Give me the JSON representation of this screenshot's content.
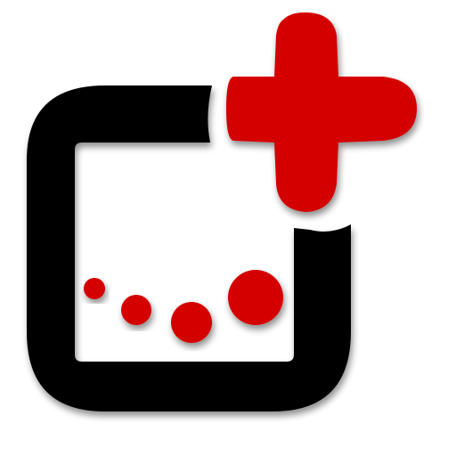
{
  "icon": {
    "name": "medical-app-logo-icon",
    "colors": {
      "frame": "#000000",
      "accent": "#d40000",
      "background": "#ffffff"
    },
    "dots_count": 4
  }
}
